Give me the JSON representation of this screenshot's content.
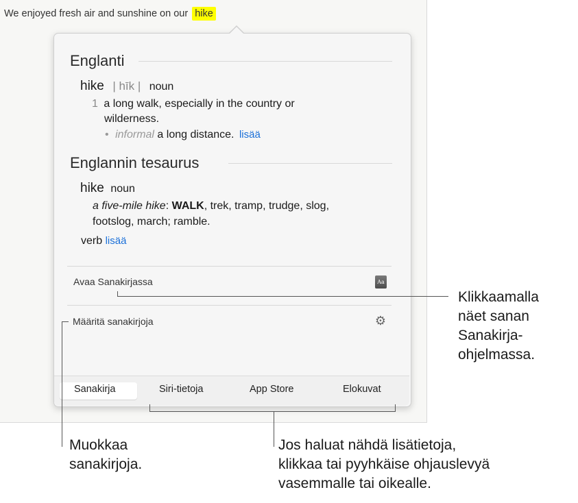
{
  "document": {
    "sentence_prefix": "We enjoyed fresh air and sunshine on our ",
    "highlighted_word": "hike"
  },
  "popover": {
    "dictionary": {
      "title": "Englanti",
      "headword": "hike",
      "pronunciation": "| hīk |",
      "part_of_speech": "noun",
      "sense_number": "1",
      "sense_line1": "a long walk, especially in the country or",
      "sense_line2": "wilderness.",
      "bullet": "•",
      "subsense_label": "informal",
      "subsense_text": "a long distance.",
      "more_link": "lisää"
    },
    "thesaurus": {
      "title": "Englannin tesaurus",
      "headword": "hike",
      "part_of_speech": "noun",
      "example": "a five-mile hike",
      "colon": ":",
      "key_synonym": "WALK",
      "synonyms_line1_rest": ", trek, tramp, trudge, slog,",
      "synonyms_line2": "footslog, march; ramble.",
      "verb_label": "verb",
      "more_link": "lisää"
    },
    "open_in_dictionary": "Avaa Sanakirjassa",
    "dictionary_icon_text": "Aa",
    "configure_dictionaries": "Määritä sanakirjoja",
    "tabs": [
      "Sanakirja",
      "Siri-tietoja",
      "App Store",
      "Elokuvat"
    ],
    "selected_tab": "Sanakirja"
  },
  "callouts": {
    "open_dictionary": [
      "Klikkaamalla",
      "näet sanan",
      "Sanakirja-",
      "ohjelmassa."
    ],
    "edit_dictionaries": [
      "Muokkaa",
      "sanakirjoja."
    ],
    "swipe": [
      "Jos haluat nähdä lisätietoja,",
      "klikkaa tai pyyhkäise ohjauslevyä",
      "vasemmalle tai oikealle."
    ]
  },
  "icons": {
    "dictionary": "dictionary-book-icon",
    "settings": "gear-icon"
  },
  "colors": {
    "highlight": "#ffff00",
    "link": "#1a6fd8",
    "popover_background": "#f6f6f6"
  }
}
